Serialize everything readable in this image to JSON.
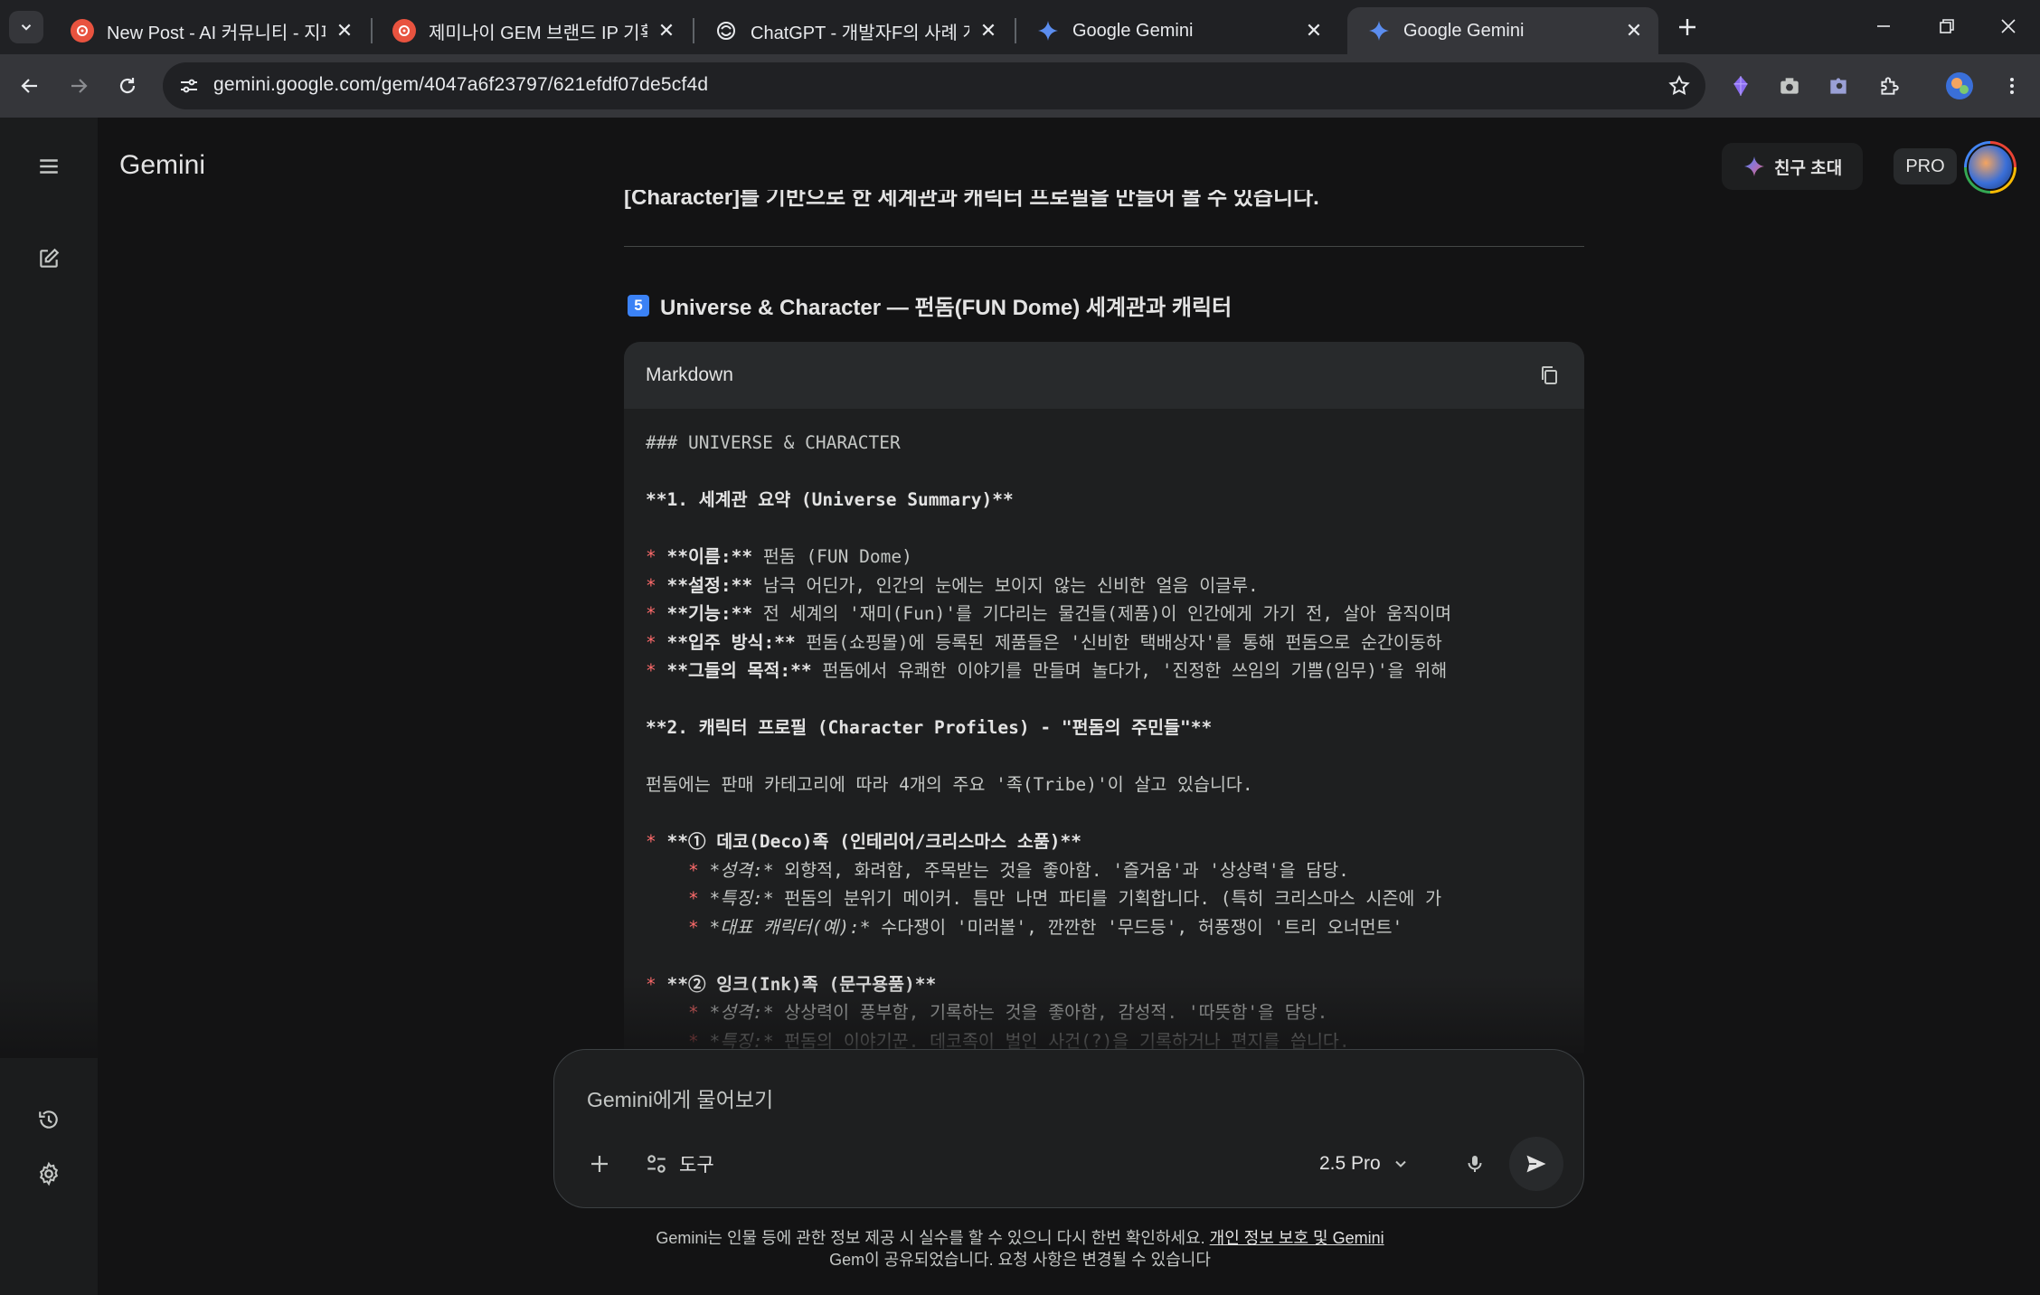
{
  "browser": {
    "tabs": [
      {
        "title": "New Post - AI 커뮤니티 - 지피",
        "favicon": "gpters-icon",
        "active": false
      },
      {
        "title": "제미나이 GEM 브랜드 IP 기획",
        "favicon": "gpters-icon",
        "active": false
      },
      {
        "title": "ChatGPT - 개발자F의 사례 게시",
        "favicon": "chatgpt-icon",
        "active": false
      },
      {
        "title": "Google Gemini",
        "favicon": "gemini-sparkle-icon",
        "active": false
      },
      {
        "title": "Google Gemini",
        "favicon": "gemini-sparkle-icon",
        "active": true
      }
    ],
    "url": "gemini.google.com/gem/4047a6f23797/621efdf07de5cf4d"
  },
  "app": {
    "title": "Gemini",
    "invite_label": "친구 초대",
    "pro_badge": "PRO"
  },
  "chat": {
    "cut_text": "[Character]를 기반으로 한 세계관과 캐릭터 프로필을 만들어 볼 수 있습니다.",
    "section_number": "5",
    "section_title": "Universe & Character — 펀돔(FUN Dome) 세계관과 캐릭터",
    "code_language": "Markdown",
    "code_lines": [
      [
        {
          "t": "### UNIVERSE & CHARACTER",
          "c": ""
        }
      ],
      [
        {
          "t": "",
          "c": ""
        }
      ],
      [
        {
          "t": "**1. 세계관 요약 (Universe Summary)**",
          "c": "b"
        }
      ],
      [
        {
          "t": "",
          "c": ""
        }
      ],
      [
        {
          "t": "* ",
          "c": "bul"
        },
        {
          "t": "**이름:**",
          "c": "b"
        },
        {
          "t": " 펀돔 (FUN Dome)",
          "c": ""
        }
      ],
      [
        {
          "t": "* ",
          "c": "bul"
        },
        {
          "t": "**설정:**",
          "c": "b"
        },
        {
          "t": " 남극 어딘가, 인간의 눈에는 보이지 않는 신비한 얼음 이글루.",
          "c": ""
        }
      ],
      [
        {
          "t": "* ",
          "c": "bul"
        },
        {
          "t": "**기능:**",
          "c": "b"
        },
        {
          "t": " 전 세계의 '재미(Fun)'를 기다리는 물건들(제품)이 인간에게 가기 전, 살아 움직이며",
          "c": ""
        }
      ],
      [
        {
          "t": "* ",
          "c": "bul"
        },
        {
          "t": "**입주 방식:**",
          "c": "b"
        },
        {
          "t": " 펀돔(쇼핑몰)에 등록된 제품들은 '신비한 택배상자'를 통해 펀돔으로 순간이동하",
          "c": ""
        }
      ],
      [
        {
          "t": "* ",
          "c": "bul"
        },
        {
          "t": "**그들의 목적:**",
          "c": "b"
        },
        {
          "t": " 펀돔에서 유쾌한 이야기를 만들며 놀다가, '진정한 쓰임의 기쁨(임무)'을 위해",
          "c": ""
        }
      ],
      [
        {
          "t": "",
          "c": ""
        }
      ],
      [
        {
          "t": "**2. 캐릭터 프로필 (Character Profiles) - \"펀돔의 주민들\"**",
          "c": "b"
        }
      ],
      [
        {
          "t": "",
          "c": ""
        }
      ],
      [
        {
          "t": "펀돔에는 판매 카테고리에 따라 4개의 주요 '족(Tribe)'이 살고 있습니다.",
          "c": ""
        }
      ],
      [
        {
          "t": "",
          "c": ""
        }
      ],
      [
        {
          "t": "* ",
          "c": "bul"
        },
        {
          "t": "**① 데코(Deco)족 (인테리어/크리스마스 소품)**",
          "c": "b"
        }
      ],
      [
        {
          "t": "    * ",
          "c": "bul"
        },
        {
          "t": "*성격:*",
          "c": "it"
        },
        {
          "t": " 외향적, 화려함, 주목받는 것을 좋아함. '즐거움'과 '상상력'을 담당.",
          "c": ""
        }
      ],
      [
        {
          "t": "    * ",
          "c": "bul"
        },
        {
          "t": "*특징:*",
          "c": "it"
        },
        {
          "t": " 펀돔의 분위기 메이커. 틈만 나면 파티를 기획합니다. (특히 크리스마스 시즌에 가",
          "c": ""
        }
      ],
      [
        {
          "t": "    * ",
          "c": "bul"
        },
        {
          "t": "*대표 캐릭터(예):*",
          "c": "it"
        },
        {
          "t": " 수다쟁이 '미러볼', 깐깐한 '무드등', 허풍쟁이 '트리 오너먼트'",
          "c": ""
        }
      ],
      [
        {
          "t": "",
          "c": ""
        }
      ],
      [
        {
          "t": "* ",
          "c": "bul"
        },
        {
          "t": "**② 잉크(Ink)족 (문구용품)**",
          "c": "b"
        }
      ],
      [
        {
          "t": "    * ",
          "c": "bul"
        },
        {
          "t": "*성격:*",
          "c": "it"
        },
        {
          "t": " 상상력이 풍부함, 기록하는 것을 좋아함, 감성적. '따뜻함'을 담당.",
          "c": ""
        }
      ],
      [
        {
          "t": "    * ",
          "c": "bul"
        },
        {
          "t": "*특징:*",
          "c": "it"
        },
        {
          "t": " 펀돔의 이야기꾼. 데코족이 벌인 사건(?)을 기록하거나 편지를 씁니다.",
          "c": ""
        }
      ]
    ]
  },
  "composer": {
    "placeholder": "Gemini에게 물어보기",
    "tools_label": "도구",
    "model_label": "2.5 Pro"
  },
  "footer": {
    "line1_text": "Gemini는 인물 등에 관한 정보 제공 시 실수를 할 수 있으니 다시 한번 확인하세요. ",
    "line1_link": "개인 정보 보호 및 Gemini",
    "line2_text": "Gem이 공유되었습니다. 요청 사항은 변경될 수 있습니다"
  },
  "colors": {
    "background": "#131314",
    "sidebar": "#1b1c1d",
    "code_bg": "#1e1f20",
    "code_header": "#282a2c",
    "bullet": "#ff6b6b",
    "badge": "#3b82f6"
  }
}
